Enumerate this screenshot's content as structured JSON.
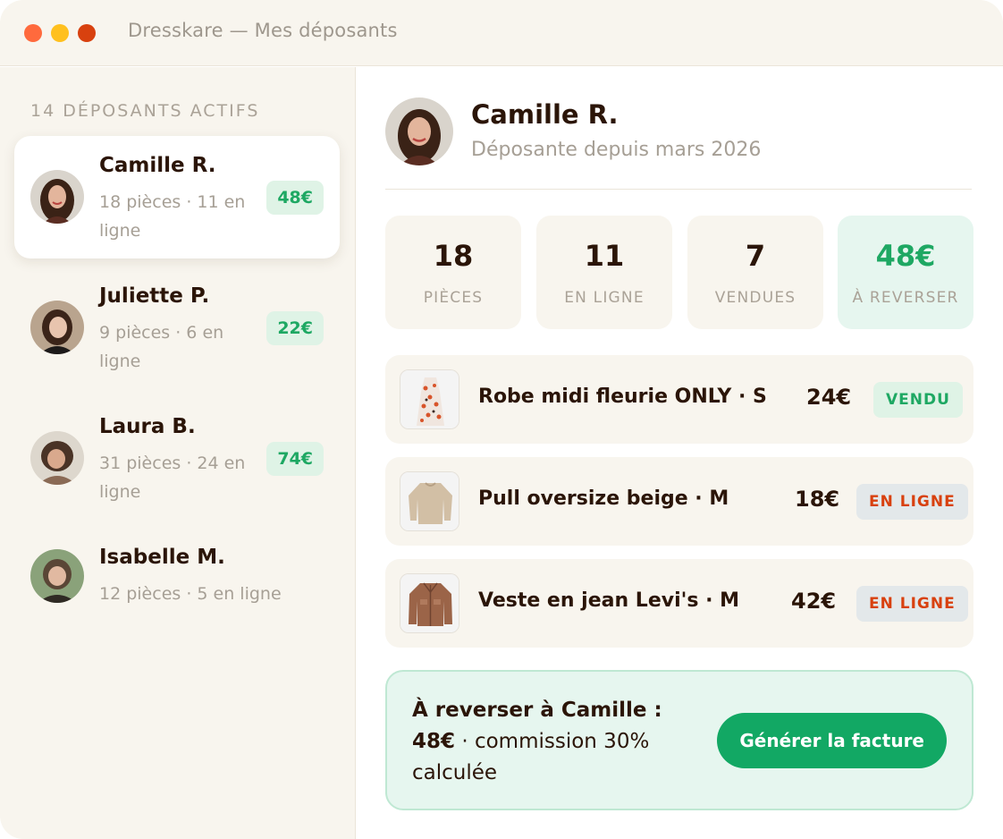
{
  "window": {
    "title": "Dresskare — Mes déposants"
  },
  "sidebar": {
    "heading": "14 DÉPOSANTS ACTIFS",
    "depositors": [
      {
        "name": "Camille R.",
        "meta": "18 pièces · 11 en ligne",
        "amount": "48€"
      },
      {
        "name": "Juliette P.",
        "meta": "9 pièces · 6 en ligne",
        "amount": "22€"
      },
      {
        "name": "Laura B.",
        "meta": "31 pièces · 24 en ligne",
        "amount": "74€"
      },
      {
        "name": "Isabelle M.",
        "meta": "12 pièces · 5 en ligne",
        "amount": ""
      }
    ]
  },
  "profile": {
    "name": "Camille R.",
    "subtitle": "Déposante depuis mars 2026"
  },
  "stats": [
    {
      "value": "18",
      "label": "PIÈCES"
    },
    {
      "value": "11",
      "label": "EN LIGNE"
    },
    {
      "value": "7",
      "label": "VENDUES"
    },
    {
      "value": "48€",
      "label": "À REVERSER"
    }
  ],
  "items": [
    {
      "title": "Robe midi fleurie ONLY · S",
      "price": "24€",
      "status": "VENDU"
    },
    {
      "title": "Pull oversize beige · M",
      "price": "18€",
      "status": "EN LIGNE"
    },
    {
      "title": "Veste en jean Levi's · M",
      "price": "42€",
      "status": "EN LIGNE"
    }
  ],
  "payout": {
    "heading": "À reverser à Camille :",
    "amount": "48€",
    "detail": " · commission 30% calculée",
    "button_label": "Générer la facture"
  },
  "colors": {
    "accent_green": "#12a864",
    "accent_orange": "#d8410f",
    "background_beige": "#f8f5ee"
  }
}
